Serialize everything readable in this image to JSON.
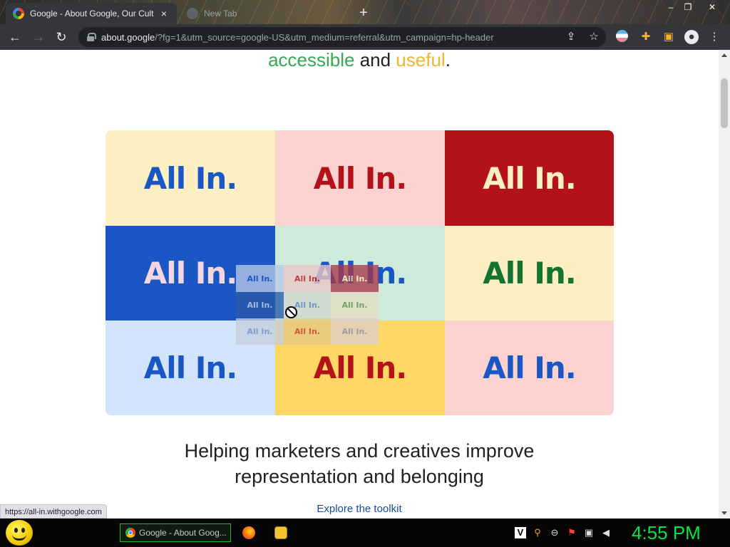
{
  "browser": {
    "tabs": [
      {
        "title": "Google - About Google, Our Cult",
        "active": true
      },
      {
        "title": "New Tab",
        "active": false
      }
    ],
    "url_host": "about.google",
    "url_rest": "/?fg=1&utm_source=google-US&utm_medium=referral&utm_campaign=hp-header",
    "status_url": "https://all-in.withgoogle.com"
  },
  "page": {
    "tagline": {
      "word1": "accessible",
      "and": " and ",
      "word2": "useful",
      "end": "."
    },
    "grid": [
      {
        "text": "All In.",
        "bg": "#fdefc4",
        "fg": "#1a56c4"
      },
      {
        "text": "All In.",
        "bg": "#fad2cf",
        "fg": "#b3121a"
      },
      {
        "text": "All In.",
        "bg": "#b3121a",
        "fg": "#fdefc4"
      },
      {
        "text": "All In.",
        "bg": "#1a56c4",
        "fg": "#f5d6e0"
      },
      {
        "text": "All In.",
        "bg": "#cdeadb",
        "fg": "#1a56c4"
      },
      {
        "text": "All In.",
        "bg": "#fdefc4",
        "fg": "#137333"
      },
      {
        "text": "All In.",
        "bg": "#d2e3fc",
        "fg": "#1a56c4"
      },
      {
        "text": "All In.",
        "bg": "#fed663",
        "fg": "#b3121a"
      },
      {
        "text": "All In.",
        "bg": "#fad2cf",
        "fg": "#1a56c4"
      }
    ],
    "drag_preview": [
      {
        "text": "All In.",
        "bg": "#b7c9e8",
        "fg": "#1a56c4"
      },
      {
        "text": "All In.",
        "bg": "#ecc8c6",
        "fg": "#b3121a"
      },
      {
        "text": "All In.",
        "bg": "#a8384a",
        "fg": "#fdefc4"
      },
      {
        "text": "All In.",
        "bg": "#2a5aa8",
        "fg": "#c9d7ef"
      },
      {
        "text": "All In.",
        "bg": "#cfd8cf",
        "fg": "#5a7fbf"
      },
      {
        "text": "All In.",
        "bg": "#e4dfc2",
        "fg": "#5a8a50"
      },
      {
        "text": "All In.",
        "bg": "#c6cfdc",
        "fg": "#6a8ac0"
      },
      {
        "text": "All In.",
        "bg": "#e5c982",
        "fg": "#c0392b"
      },
      {
        "text": "All In.",
        "bg": "#e0cfcb",
        "fg": "#8a8ab0"
      }
    ],
    "heading_line1": "Helping marketers and creatives improve",
    "heading_line2": "representation and belonging",
    "link": "Explore the toolkit"
  },
  "taskbar": {
    "task_label": "Google - About Goog...",
    "clock": "4:55 PM"
  },
  "icons": {
    "back": "arrow-left-icon",
    "forward": "arrow-right-icon",
    "reload": "reload-icon",
    "share": "share-icon",
    "bookmark": "star-icon",
    "extensions": "puzzle-icon",
    "sidepanel": "side-panel-icon",
    "profile": "profile-icon",
    "menu": "kebab-menu-icon"
  }
}
